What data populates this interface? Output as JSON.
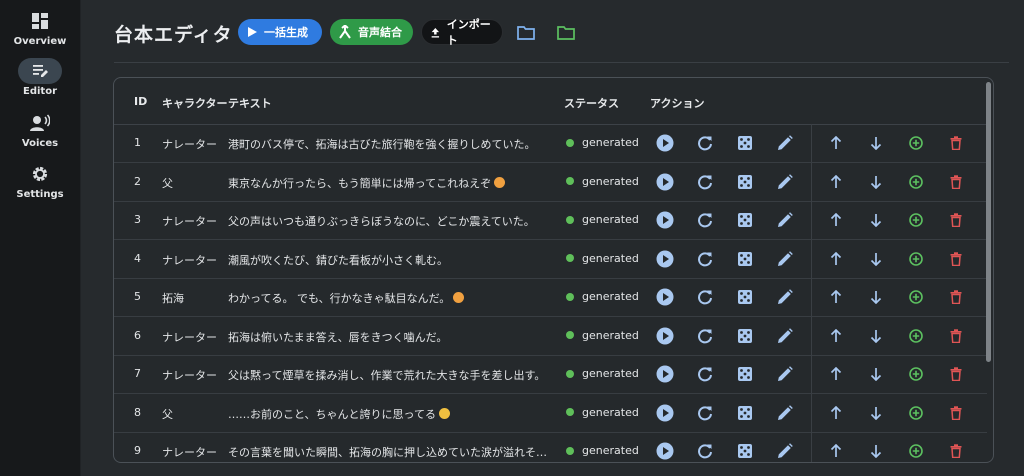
{
  "sidebar": {
    "items": [
      {
        "label": "Overview",
        "icon": "dashboard-icon"
      },
      {
        "label": "Editor",
        "icon": "edit-note-icon",
        "active": true
      },
      {
        "label": "Voices",
        "icon": "voice-icon"
      },
      {
        "label": "Settings",
        "icon": "gear-icon"
      }
    ]
  },
  "header": {
    "title": "台本エディタ",
    "generate_label": "一括生成",
    "merge_label": "音声結合",
    "import_label": "インポート"
  },
  "colors": {
    "accent_blue": "#2f7be0",
    "accent_green": "#2f9a48",
    "status_generated": "#5fbf5a",
    "action_icon": "#a9c8f0",
    "delete_red": "#e05555",
    "add_green": "#5cc060"
  },
  "table": {
    "columns": {
      "id": "ID",
      "character": "キャラクター",
      "text": "テキスト",
      "status": "ステータス",
      "action": "アクション"
    },
    "rows": [
      {
        "id": "1",
        "character": "ナレーター",
        "text": "港町のバス停で、拓海は古びた旅行鞄を強く握りしめていた。",
        "status": "generated"
      },
      {
        "id": "2",
        "character": "父",
        "text": "東京なんか行ったら、もう簡単には帰ってこれねえぞ",
        "status": "generated",
        "emoji": "#f0a040"
      },
      {
        "id": "3",
        "character": "ナレーター",
        "text": "父の声はいつも通りぶっきらぼうなのに、どこか震えていた。",
        "status": "generated"
      },
      {
        "id": "4",
        "character": "ナレーター",
        "text": "潮風が吹くたび、錆びた看板が小さく軋む。",
        "status": "generated"
      },
      {
        "id": "5",
        "character": "拓海",
        "text": "わかってる。 でも、行かなきゃ駄目なんだ。",
        "status": "generated",
        "emoji": "#f0a040"
      },
      {
        "id": "6",
        "character": "ナレーター",
        "text": "拓海は俯いたまま答え、唇をきつく噛んだ。",
        "status": "generated"
      },
      {
        "id": "7",
        "character": "ナレーター",
        "text": "父は黙って煙草を揉み消し、作業で荒れた大きな手を差し出す。",
        "status": "generated"
      },
      {
        "id": "8",
        "character": "父",
        "text": "……お前のこと、ちゃんと誇りに思ってる",
        "status": "generated",
        "emoji": "#f0c040"
      },
      {
        "id": "9",
        "character": "ナレーター",
        "text": "その言葉を聞いた瞬間、拓海の胸に押し込めていた涙が溢れそうにな…",
        "status": "generated"
      }
    ]
  }
}
